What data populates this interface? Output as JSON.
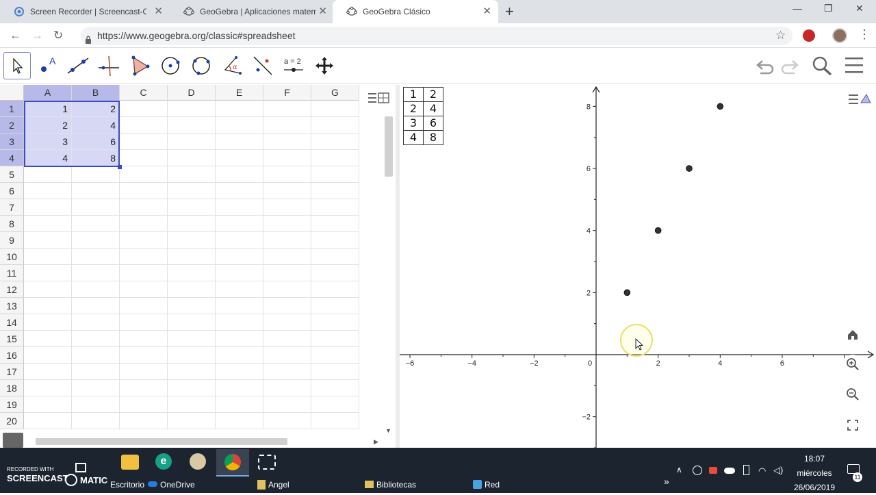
{
  "browser": {
    "tabs": [
      {
        "label": "Screen Recorder | Screencast-O-M",
        "active": false,
        "icon": "screencast-icon"
      },
      {
        "label": "GeoGebra | Aplicaciones matemá",
        "active": false,
        "icon": "geogebra-icon"
      },
      {
        "label": "GeoGebra Clásico",
        "active": true,
        "icon": "geogebra-icon"
      }
    ],
    "new_tab": "+",
    "url": "https://www.geogebra.org/classic#spreadsheet",
    "window_controls": {
      "minimize": "—",
      "restore": "❐",
      "close": "✕"
    },
    "nav": {
      "back": "←",
      "forward": "→",
      "reload": "↻"
    }
  },
  "toolbar": {
    "tools": [
      "move-tool",
      "point-tool",
      "line-tool",
      "perpendicular-tool",
      "polygon-tool",
      "circle-tool",
      "circle-three-points-tool",
      "angle-tool",
      "reflect-tool",
      "slider-tool",
      "move-graphics-tool"
    ],
    "slider_label": "a = 2",
    "right": [
      "undo-icon",
      "redo-icon",
      "search-icon",
      "menu-icon"
    ]
  },
  "spreadsheet": {
    "columns": [
      "A",
      "B",
      "C",
      "D",
      "E",
      "F",
      "G"
    ],
    "rows": [
      "1",
      "2",
      "3",
      "4",
      "5",
      "6",
      "7",
      "8",
      "9",
      "10",
      "11",
      "12",
      "13",
      "14",
      "15",
      "16",
      "17",
      "18",
      "19",
      "20"
    ],
    "cells": [
      [
        "1",
        "2"
      ],
      [
        "2",
        "4"
      ],
      [
        "3",
        "6"
      ],
      [
        "4",
        "8"
      ]
    ],
    "selection": "A1:B4"
  },
  "graphics": {
    "table": [
      [
        "1",
        "2"
      ],
      [
        "2",
        "4"
      ],
      [
        "3",
        "6"
      ],
      [
        "4",
        "8"
      ]
    ],
    "buttons": [
      "home-icon",
      "zoom-in-icon",
      "zoom-out-icon",
      "fullscreen-icon"
    ]
  },
  "chart_data": {
    "type": "scatter",
    "points": [
      [
        1,
        2
      ],
      [
        2,
        4
      ],
      [
        3,
        6
      ],
      [
        4,
        8
      ]
    ],
    "x_ticks": [
      "−6",
      "−4",
      "−2",
      "0",
      "2",
      "4",
      "6"
    ],
    "y_ticks": [
      "8",
      "6",
      "4",
      "2",
      "−2"
    ],
    "xlim": [
      -6.3,
      9
    ],
    "ylim": [
      -3,
      8.6
    ],
    "grid": false,
    "point_color": "#333333"
  },
  "taskbar": {
    "items": [
      {
        "label": "Escritorio",
        "icon": "desktop-icon"
      },
      {
        "label": "OneDrive",
        "icon": "onedrive-icon"
      },
      {
        "label": "Angel",
        "icon": "user-folder-icon"
      },
      {
        "label": "Bibliotecas",
        "icon": "folder-icon"
      },
      {
        "label": "Red",
        "icon": "network-icon"
      }
    ],
    "pinned": [
      "file-explorer-icon",
      "eset-icon",
      "paint-icon",
      "chrome-icon",
      "snipping-icon"
    ],
    "time": "18:07",
    "day": "miércoles",
    "date": "26/06/2019",
    "notifications": "11",
    "chevron": "»",
    "watermark_line1": "RECORDED WITH",
    "watermark_line2": "SCREENCAST",
    "watermark_line3": "MATIC"
  },
  "colors": {
    "selection_border": "#3a49c9",
    "selection_fill": "#d6d8f5",
    "header_highlight": "#b7b9e8",
    "taskbar": "#1c2430"
  }
}
